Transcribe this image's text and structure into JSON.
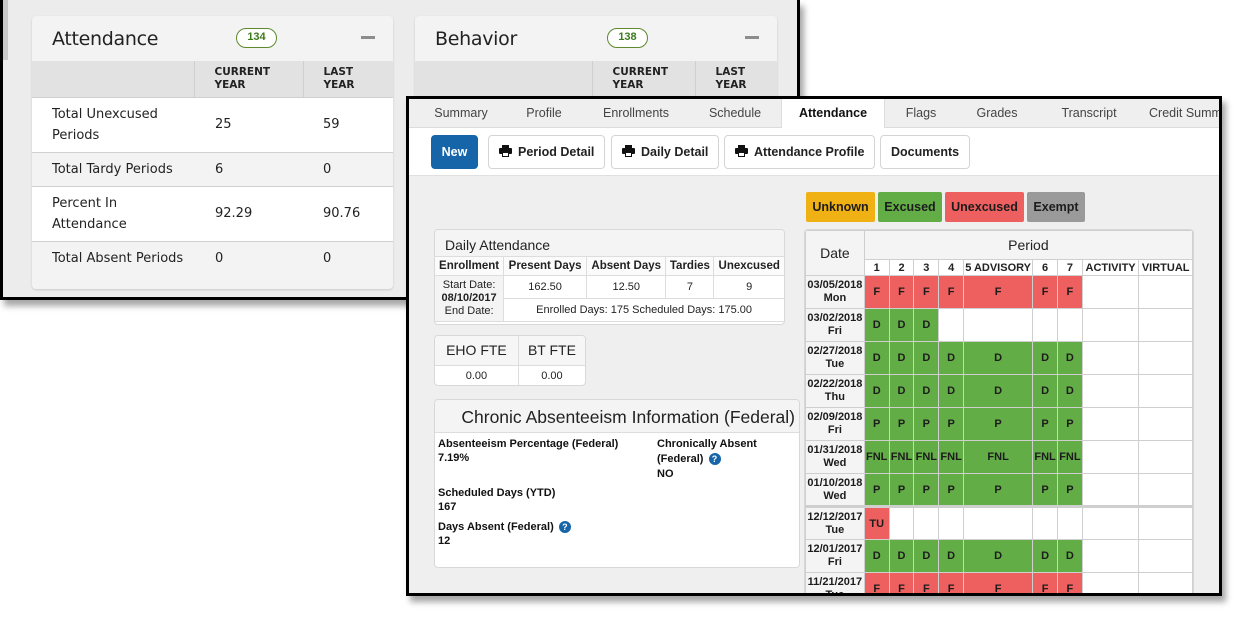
{
  "back": {
    "attendance_card": {
      "title": "Attendance",
      "badge": "134",
      "columns": [
        "",
        "CURRENT YEAR",
        "LAST YEAR"
      ],
      "rows": [
        {
          "label": "Total Unexcused Periods",
          "current": "25",
          "last": "59"
        },
        {
          "label": "Total Tardy Periods",
          "current": "6",
          "last": "0"
        },
        {
          "label": "Percent In Attendance",
          "current": "92.29",
          "last": "90.76"
        },
        {
          "label": "Total Absent Periods",
          "current": "0",
          "last": "0"
        }
      ]
    },
    "behavior_card": {
      "title": "Behavior",
      "badge": "138",
      "columns": [
        "",
        "CURRENT YEAR",
        "LAST YEAR"
      ]
    }
  },
  "front": {
    "tabs": [
      {
        "label": "Summary"
      },
      {
        "label": "Profile"
      },
      {
        "label": "Enrollments"
      },
      {
        "label": "Schedule"
      },
      {
        "label": "Attendance",
        "active": true
      },
      {
        "label": "Flags"
      },
      {
        "label": "Grades"
      },
      {
        "label": "Transcript"
      },
      {
        "label": "Credit Summ"
      }
    ],
    "toolbar": {
      "new_label": "New",
      "period_detail_label": "Period Detail",
      "daily_detail_label": "Daily Detail",
      "attendance_profile_label": "Attendance Profile",
      "documents_label": "Documents"
    },
    "legend": {
      "unknown": "Unknown",
      "excused": "Excused",
      "unexcused": "Unexcused",
      "exempt": "Exempt",
      "colors": {
        "unknown": "#f0b114",
        "excused": "#63ad47",
        "unexcused": "#ee6060",
        "exempt": "#9a9a9a"
      }
    },
    "daily_attendance": {
      "title": "Daily Attendance",
      "headers": [
        "Enrollment",
        "Present Days",
        "Absent Days",
        "Tardies",
        "Unexcused"
      ],
      "start_label": "Start Date:",
      "start_date": "08/10/2017",
      "end_label": "End Date:",
      "present_days": "162.50",
      "absent_days": "12.50",
      "tardies": "7",
      "unexcused": "9",
      "summary": "Enrolled Days: 175 Scheduled Days: 175.00"
    },
    "fte": {
      "headers": [
        "EHO FTE",
        "BT FTE"
      ],
      "values": [
        "0.00",
        "0.00"
      ]
    },
    "chronic": {
      "title": "Chronic Absenteeism Information (Federal)",
      "absenteeism_label": "Absenteeism Percentage (Federal)",
      "absenteeism_value": "7.19%",
      "chronically_label_1": "Chronically Absent",
      "chronically_label_2": "(Federal)",
      "chronically_value": "NO",
      "scheduled_label": "Scheduled Days (YTD)",
      "scheduled_value": "167",
      "days_absent_label": "Days Absent (Federal)",
      "days_absent_value": "12"
    },
    "period_grid": {
      "date_header": "Date",
      "period_header": "Period",
      "periods": [
        "1",
        "2",
        "3",
        "4",
        "5 ADVISORY",
        "6",
        "7",
        "ACTIVITY",
        "VIRTUAL"
      ],
      "rows": [
        {
          "date": "03/05/2018",
          "day": "Mon",
          "codes": [
            "F",
            "F",
            "F",
            "F",
            "F",
            "F",
            "F",
            "",
            ""
          ]
        },
        {
          "date": "03/02/2018",
          "day": "Fri",
          "codes": [
            "D",
            "D",
            "D",
            "",
            "",
            "",
            "",
            "",
            ""
          ]
        },
        {
          "date": "02/27/2018",
          "day": "Tue",
          "codes": [
            "D",
            "D",
            "D",
            "D",
            "D",
            "D",
            "D",
            "",
            ""
          ]
        },
        {
          "date": "02/22/2018",
          "day": "Thu",
          "codes": [
            "D",
            "D",
            "D",
            "D",
            "D",
            "D",
            "D",
            "",
            ""
          ]
        },
        {
          "date": "02/09/2018",
          "day": "Fri",
          "codes": [
            "P",
            "P",
            "P",
            "P",
            "P",
            "P",
            "P",
            "",
            ""
          ]
        },
        {
          "date": "01/31/2018",
          "day": "Wed",
          "codes": [
            "FNL",
            "FNL",
            "FNL",
            "FNL",
            "FNL",
            "FNL",
            "FNL",
            "",
            ""
          ]
        },
        {
          "date": "01/10/2018",
          "day": "Wed",
          "codes": [
            "P",
            "P",
            "P",
            "P",
            "P",
            "P",
            "P",
            "",
            ""
          ]
        },
        {
          "date": "12/12/2017",
          "day": "Tue",
          "codes": [
            "TU",
            "",
            "",
            "",
            "",
            "",
            "",
            "",
            ""
          ],
          "term_break": true
        },
        {
          "date": "12/01/2017",
          "day": "Fri",
          "codes": [
            "D",
            "D",
            "D",
            "D",
            "D",
            "D",
            "D",
            "",
            ""
          ]
        },
        {
          "date": "11/21/2017",
          "day": "Tue",
          "codes": [
            "F",
            "F",
            "F",
            "F",
            "F",
            "F",
            "F",
            "",
            ""
          ]
        }
      ]
    }
  }
}
